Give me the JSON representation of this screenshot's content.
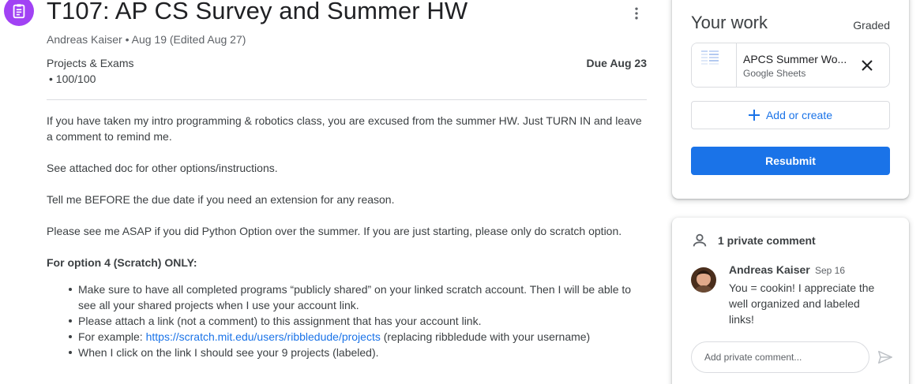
{
  "assignment": {
    "icon": "assignment-icon",
    "title": "T107: AP CS Survey and Summer HW",
    "meta": "Andreas Kaiser • Aug 19 (Edited Aug 27)",
    "category": "Projects & Exams",
    "points": "• 100/100",
    "due": "Due Aug 23",
    "more_icon": "more-vert-icon"
  },
  "body": {
    "paragraphs": [
      "If you have taken my intro programming & robotics class, you are excused from the summer HW. Just TURN IN and leave a comment to remind me.",
      "See attached doc for other options/instructions.",
      "Tell me BEFORE the due date if you need an extension for any reason.",
      "Please see me ASAP if you did Python Option over the summer. If you are just starting, please only do scratch option."
    ],
    "option_heading": "For option 4 (Scratch) ONLY:",
    "bullets": [
      "Make sure to have all completed programs “publicly shared” on your linked scratch account. Then I will be able to see all your shared projects when I use your account link.",
      "Please attach a link (not a comment) to this assignment that has your account link."
    ],
    "example_prefix": "For example: ",
    "example_link": "https://scratch.mit.edu/users/ribbledude/projects",
    "example_suffix": " (replacing ribbledude with your username)",
    "last_bullet": "When I click on the link I should see your 9 projects (labeled)."
  },
  "your_work": {
    "title": "Your work",
    "status": "Graded",
    "attachment": {
      "name": "APCS Summer Wo...",
      "type": "Google Sheets",
      "thumb_icon": "sheets-thumbnail",
      "close_icon": "close-icon"
    },
    "add_label": "Add or create",
    "add_icon": "plus-icon",
    "resubmit_label": "Resubmit"
  },
  "private_comments": {
    "header": "1 private comment",
    "header_icon": "person-icon",
    "comment": {
      "author": "Andreas Kaiser",
      "date": "Sep 16",
      "text": "You = cookin! I appreciate the well organized and labeled links!"
    },
    "input_placeholder": "Add private comment...",
    "send_icon": "send-icon"
  },
  "colors": {
    "accent": "#1a73e8",
    "assignment_icon_bg": "#a142f4",
    "text": "#3c4043",
    "muted": "#5f6368",
    "border": "#dadce0"
  }
}
